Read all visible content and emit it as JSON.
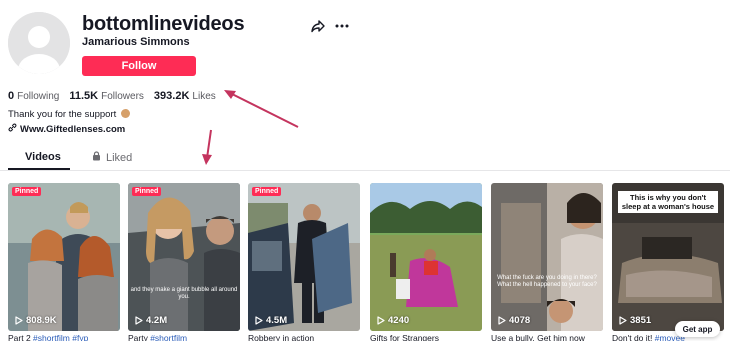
{
  "profile": {
    "username": "bottomlinevideos",
    "nickname": "Jamarious Simmons",
    "follow_label": "Follow",
    "stats": {
      "following_count": "0",
      "following_label": "Following",
      "followers_count": "11.5K",
      "followers_label": "Followers",
      "likes_count": "393.2K",
      "likes_label": "Likes"
    },
    "bio": "Thank you for the support",
    "link": "Www.Giftedlenses.com"
  },
  "tabs": {
    "videos": "Videos",
    "liked": "Liked"
  },
  "videos": [
    {
      "pinned": "Pinned",
      "views": "808.9K",
      "title": "Part 2 ",
      "tags": "#shortfilm #fyp"
    },
    {
      "pinned": "Pinned",
      "views": "4.2M",
      "title": "Party ",
      "tags": "#shortfilm",
      "caption": "and they make a giant bubble all around you."
    },
    {
      "pinned": "Pinned",
      "views": "4.5M",
      "title": "Robbery in action",
      "tags": ""
    },
    {
      "views": "4240",
      "title": "Gifts for Strangers ",
      "tags": ""
    },
    {
      "views": "4078",
      "title": "Use a bully. Get him now",
      "tags": "",
      "caption": "What the fuck are you doing in there? What the hell happened to your face?"
    },
    {
      "views": "3851",
      "title": "Don't do it! ",
      "tags": "#movee",
      "caption_box": "This is why you don't sleep at a woman's house"
    }
  ],
  "get_app": "Get app",
  "colors": {
    "accent": "#fe2c55",
    "text": "#161823",
    "muted": "#6b6b70",
    "arrow": "#c4345e"
  }
}
